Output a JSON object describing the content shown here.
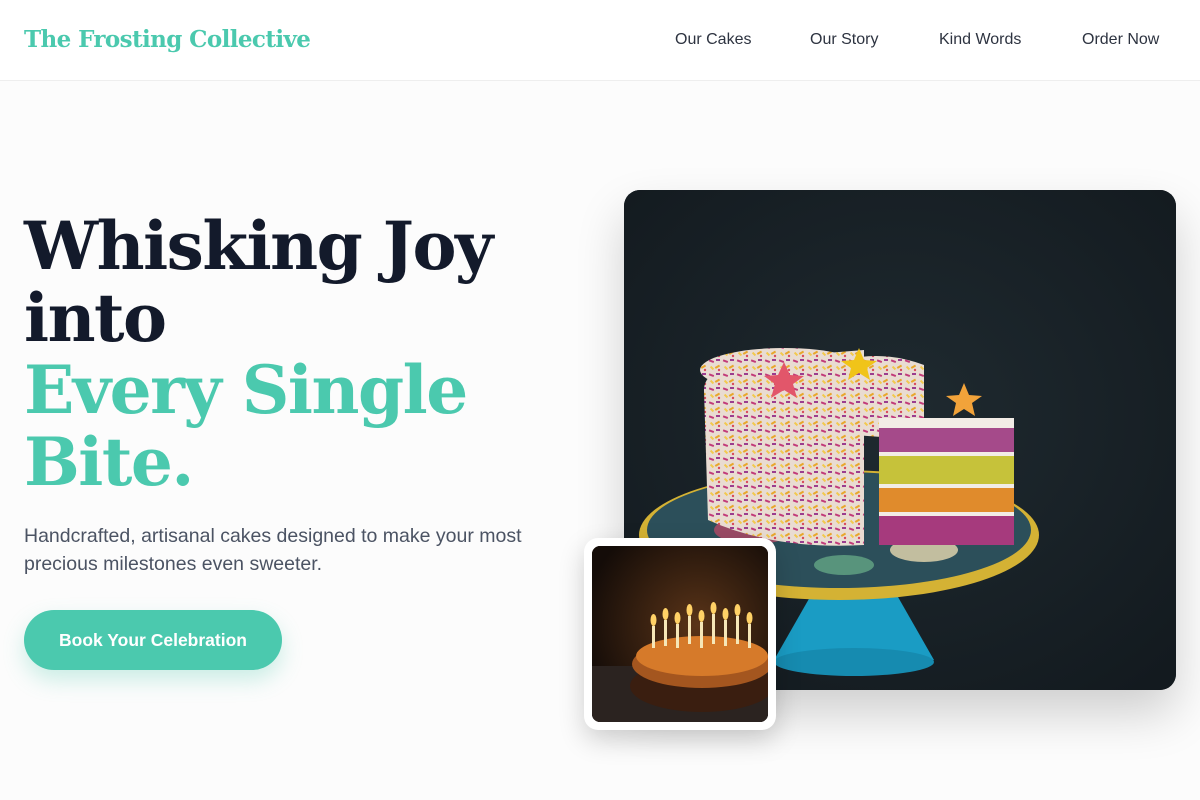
{
  "brand": {
    "name": "The Frosting Collective"
  },
  "nav": {
    "items": [
      {
        "label": "Our Cakes"
      },
      {
        "label": "Our Story"
      },
      {
        "label": "Kind Words"
      },
      {
        "label": "Order Now"
      }
    ]
  },
  "hero": {
    "title_lines": [
      "Whisking Joy",
      "into"
    ],
    "title_accent_lines": [
      "Every Single",
      "Bite."
    ],
    "subtitle": "Handcrafted, artisanal cakes designed to make your most precious milestones even sweeter.",
    "cta_label": "Book Your Celebration"
  },
  "images": {
    "main": "rainbow-layer-cake-photo",
    "thumb": "birthday-candle-cake-photo"
  },
  "colors": {
    "accent": "#4bc9ae",
    "heading": "#131a2b",
    "body_text": "#4b5363",
    "photo_background": "#161c21"
  }
}
